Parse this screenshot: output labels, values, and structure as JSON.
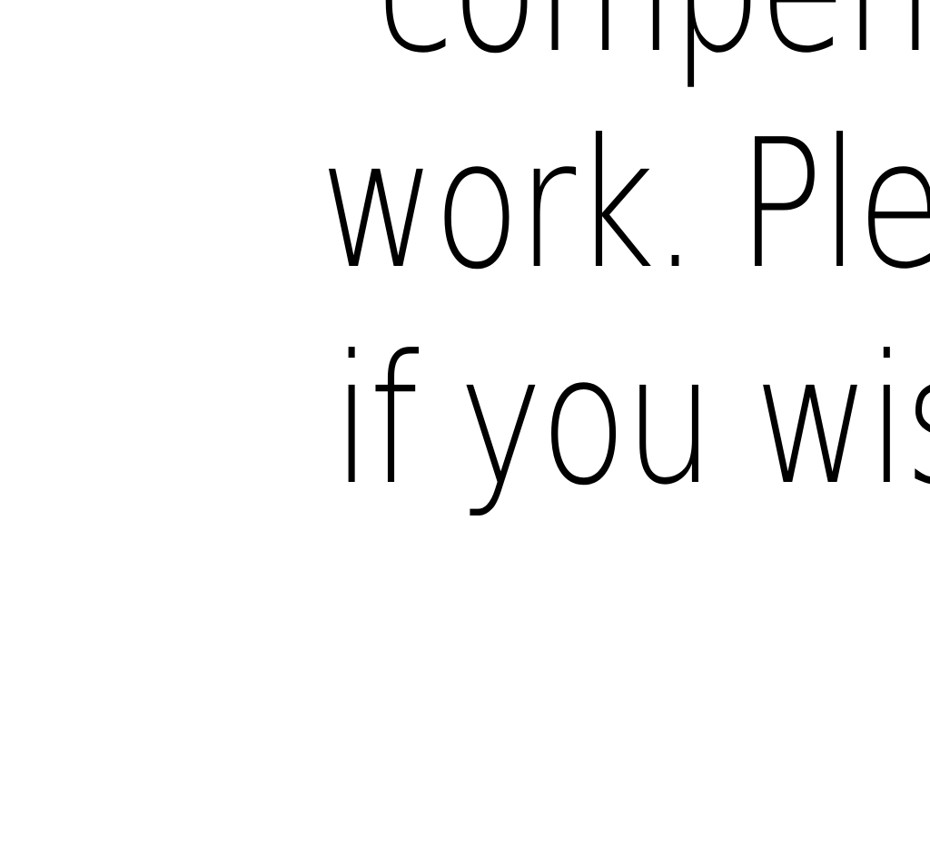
{
  "text": {
    "lines": [
      "compen",
      "work. Ple",
      "if you wis"
    ],
    "color": "#000000",
    "background": "#ffffff"
  }
}
